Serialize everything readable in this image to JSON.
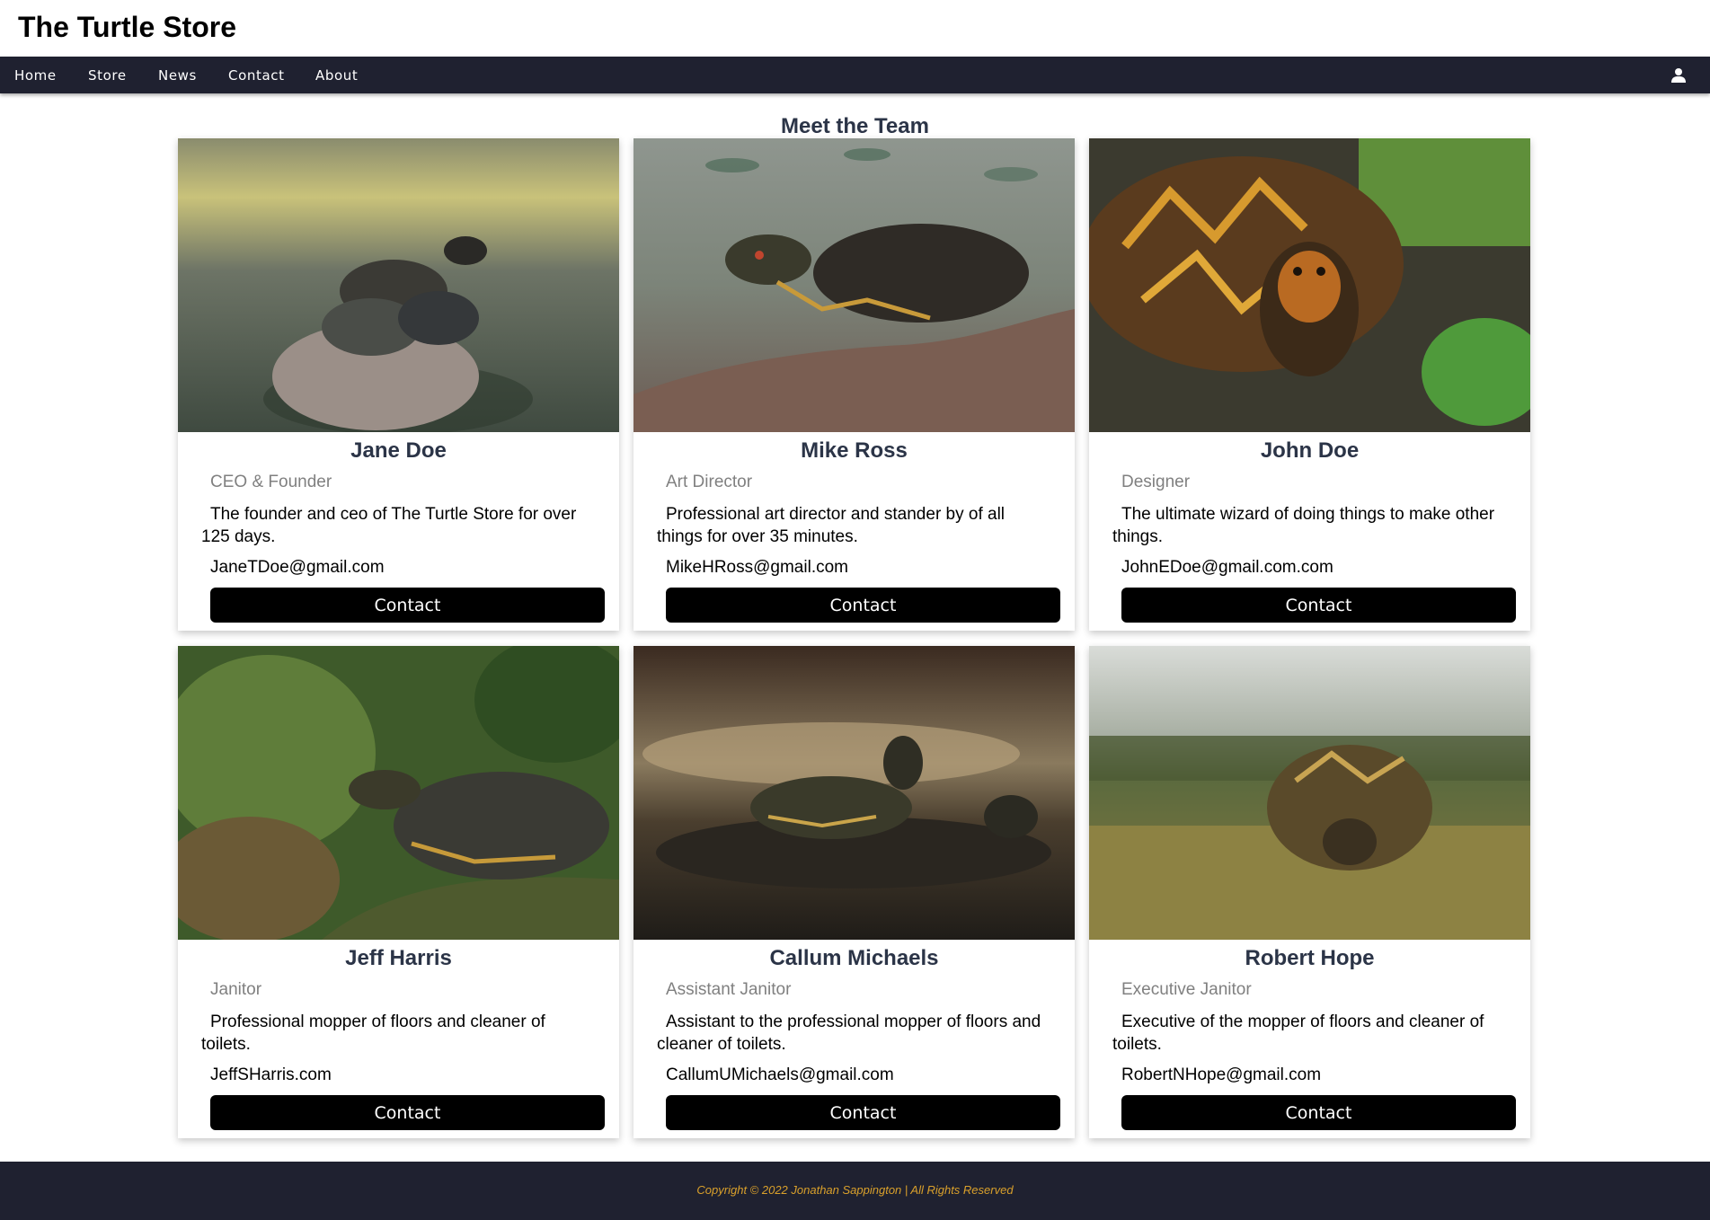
{
  "site": {
    "title": "The Turtle Store"
  },
  "nav": {
    "items": [
      "Home",
      "Store",
      "News",
      "Contact",
      "About"
    ],
    "user_icon": "user-icon"
  },
  "section": {
    "title": "Meet the Team"
  },
  "team": [
    {
      "name": "Jane Doe",
      "role": "CEO & Founder",
      "description": "The founder and ceo of The Turtle Store for over 125 days.",
      "email": "JaneTDoe@gmail.com",
      "button": "Contact"
    },
    {
      "name": "Mike Ross",
      "role": "Art Director",
      "description": "Professional art director and stander by of all things for over 35 minutes.",
      "email": "MikeHRoss@gmail.com",
      "button": "Contact"
    },
    {
      "name": "John Doe",
      "role": "Designer",
      "description": "The ultimate wizard of doing things to make other things.",
      "email": "JohnEDoe@gmail.com.com",
      "button": "Contact"
    },
    {
      "name": "Jeff Harris",
      "role": "Janitor",
      "description": "Professional mopper of floors and cleaner of toilets.",
      "email": "JeffSHarris.com",
      "button": "Contact"
    },
    {
      "name": "Callum Michaels",
      "role": "Assistant Janitor",
      "description": "Assistant to the professional mopper of floors and cleaner of toilets.",
      "email": "CallumUMichaels@gmail.com",
      "button": "Contact"
    },
    {
      "name": "Robert Hope",
      "role": "Executive Janitor",
      "description": "Executive of the mopper of floors and cleaner of toilets.",
      "email": "RobertNHope@gmail.com",
      "button": "Contact"
    }
  ],
  "footer": {
    "copyright": "Copyright © 2022 Jonathan Sappington | All Rights Reserved"
  },
  "colors": {
    "nav_bg": "#1f2130",
    "heading": "#2b3447",
    "role_text": "#808080",
    "button_bg": "#000000",
    "footer_text": "#d9a02b"
  }
}
